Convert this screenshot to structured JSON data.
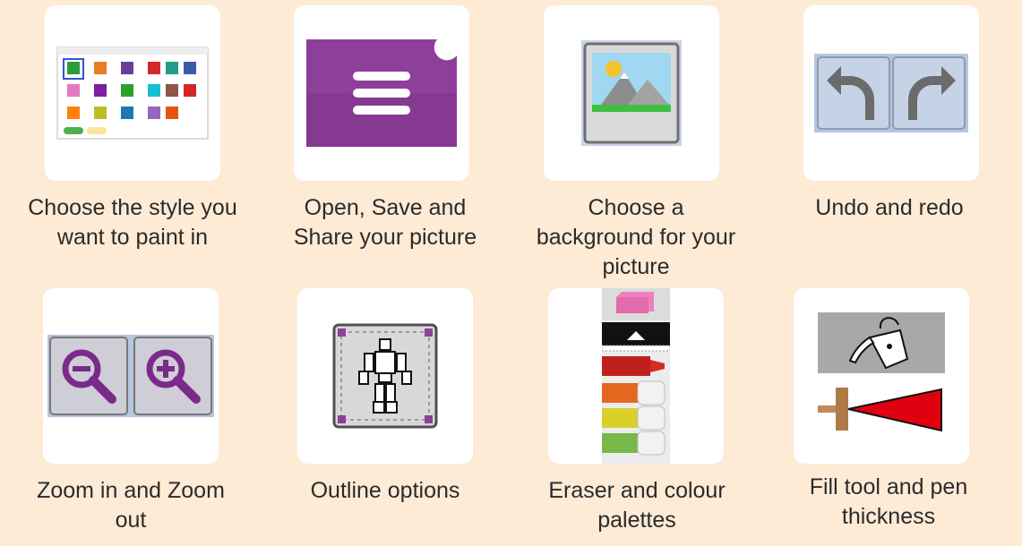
{
  "tools": [
    {
      "id": "style",
      "icon": "style-chooser-icon",
      "caption": [
        "Choose the style you",
        "want to paint in"
      ]
    },
    {
      "id": "file",
      "icon": "file-menu-icon",
      "caption": [
        "Open, Save and",
        "Share your picture"
      ]
    },
    {
      "id": "background",
      "icon": "background-picture-icon",
      "caption": [
        "Choose a",
        "background for your",
        "picture"
      ]
    },
    {
      "id": "undo-redo",
      "icon": "undo-redo-icon",
      "caption": [
        "Undo and redo"
      ]
    },
    {
      "id": "zoom",
      "icon": "zoom-in-out-icon",
      "caption": [
        "Zoom in and Zoom",
        "out"
      ]
    },
    {
      "id": "outline",
      "icon": "outline-figure-icon",
      "caption": [
        "Outline options"
      ]
    },
    {
      "id": "eraser",
      "icon": "eraser-palette-icon",
      "caption": [
        "Eraser and colour",
        "palettes"
      ]
    },
    {
      "id": "fill",
      "icon": "fill-pen-icon",
      "caption": [
        "Fill tool and pen",
        "thickness"
      ]
    }
  ],
  "colors": {
    "background": "#fdebd6",
    "card": "#ffffff",
    "purple": "#8e3f9a",
    "text": "#2b2b2b",
    "red": "#e00010"
  }
}
